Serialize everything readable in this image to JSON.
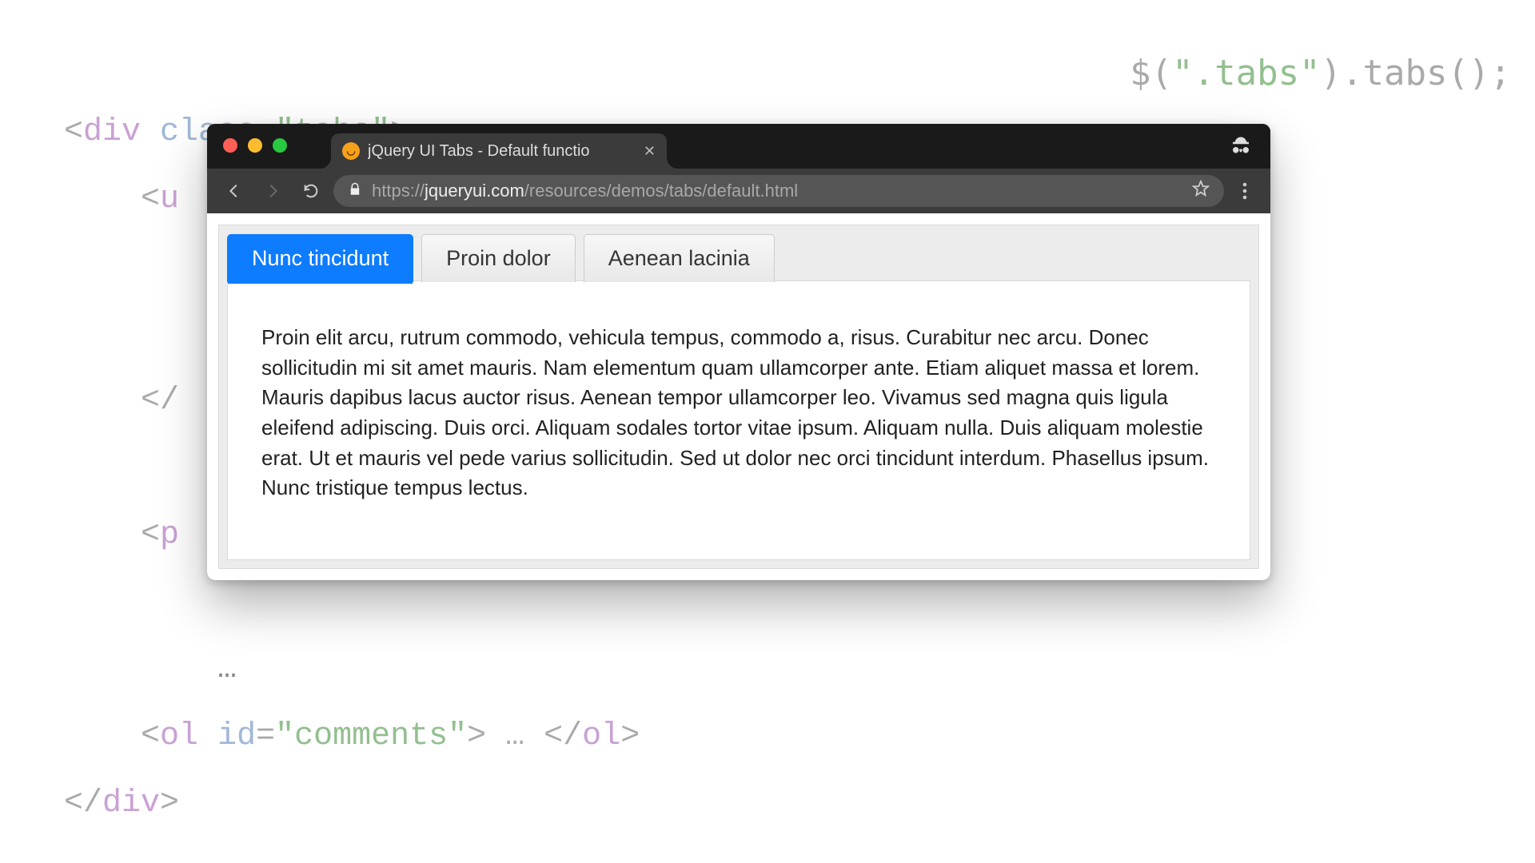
{
  "bg_code": {
    "line1_open": "<div ",
    "line1_attr": "class=",
    "line1_str": "\"tabs\"",
    "line1_close": ">",
    "line2": "    <u",
    "line3": "    </",
    "line4": "    <p",
    "line5": "    …",
    "line6_open": "    <ol ",
    "line6_attr": "id=",
    "line6_str": "\"comments\"",
    "line6_close": "> … </ol>",
    "line7": "</div>"
  },
  "bg_js": {
    "pre": "$(",
    "str": "\".tabs\"",
    "post": ").tabs();"
  },
  "browser": {
    "tab_title": "jQuery UI Tabs - Default functio",
    "url_scheme": "https://",
    "url_host": "jqueryui.com",
    "url_path": "/resources/demos/tabs/default.html"
  },
  "tabs": {
    "items": [
      {
        "label": "Nunc tincidunt",
        "active": true
      },
      {
        "label": "Proin dolor",
        "active": false
      },
      {
        "label": "Aenean lacinia",
        "active": false
      }
    ],
    "panel_text": "Proin elit arcu, rutrum commodo, vehicula tempus, commodo a, risus. Curabitur nec arcu. Donec sollicitudin mi sit amet mauris. Nam elementum quam ullamcorper ante. Etiam aliquet massa et lorem. Mauris dapibus lacus auctor risus. Aenean tempor ullamcorper leo. Vivamus sed magna quis ligula eleifend adipiscing. Duis orci. Aliquam sodales tortor vitae ipsum. Aliquam nulla. Duis aliquam molestie erat. Ut et mauris vel pede varius sollicitudin. Sed ut dolor nec orci tincidunt interdum. Phasellus ipsum. Nunc tristique tempus lectus."
  }
}
